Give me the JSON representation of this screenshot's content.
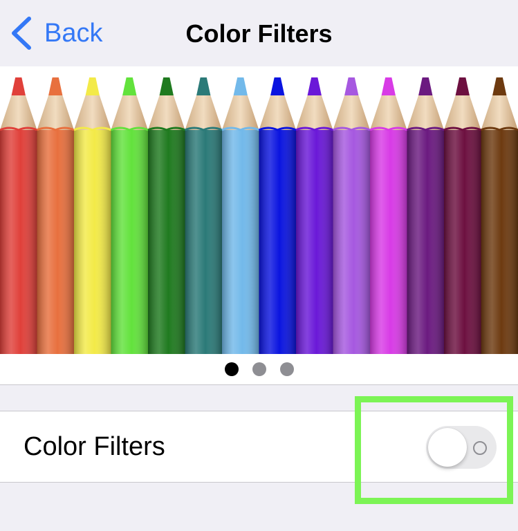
{
  "nav": {
    "back_label": "Back",
    "title": "Color Filters"
  },
  "preview": {
    "pencil_colors": [
      "#e0403a",
      "#e8703e",
      "#f3ea48",
      "#62e23c",
      "#1f7a1f",
      "#2b7a78",
      "#72b9ea",
      "#0a14e0",
      "#6a18d8",
      "#a658e0",
      "#d83be6",
      "#6b1a80",
      "#6d1040",
      "#6d3a10"
    ],
    "page_count": 3,
    "current_page": 1
  },
  "settings": {
    "color_filters_label": "Color Filters",
    "color_filters_enabled": false
  },
  "colors": {
    "accent": "#3478f6",
    "highlight": "#7cf455",
    "background": "#f0eff5"
  }
}
